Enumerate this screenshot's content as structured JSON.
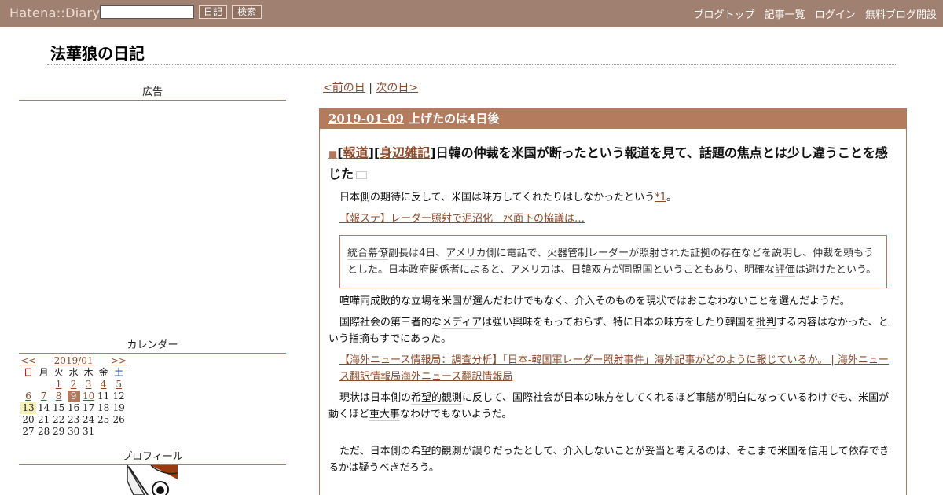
{
  "topbar": {
    "logo": "Hatena::Diary",
    "search_value": "",
    "diary_button": "日記",
    "search_button": "検索",
    "links": [
      "ブログトップ",
      "記事一覧",
      "ログイン",
      "無料ブログ開設"
    ]
  },
  "site_title": "法華狼の日記",
  "sidebar": {
    "ad_heading": "広告",
    "calendar_heading": "カレンダー",
    "profile_heading": "プロフィール",
    "calendar": {
      "prev": "<<",
      "month": "2019/01",
      "next": ">>",
      "weekdays": [
        "日",
        "月",
        "火",
        "水",
        "木",
        "金",
        "土"
      ],
      "weeks": [
        [
          "",
          "",
          "1",
          "2",
          "3",
          "4",
          "5"
        ],
        [
          "6",
          "7",
          "8",
          "9",
          "10",
          "11",
          "12"
        ],
        [
          "13",
          "14",
          "15",
          "16",
          "17",
          "18",
          "19"
        ],
        [
          "20",
          "21",
          "22",
          "23",
          "24",
          "25",
          "26"
        ],
        [
          "27",
          "28",
          "29",
          "30",
          "31",
          "",
          ""
        ]
      ],
      "linked_days": [
        "1",
        "2",
        "3",
        "4",
        "5",
        "6",
        "7",
        "8",
        "9",
        "10"
      ],
      "selected_day": "9",
      "today": "13"
    }
  },
  "pager": {
    "prev": "<前の日",
    "sep": "|",
    "next": "次の日>"
  },
  "entry": {
    "date": "2019-01-09",
    "header_title": "上げたのは4日後",
    "section": {
      "mark": "■",
      "category1": "報道",
      "category2": "身辺雑記",
      "title": "日韓の仲裁を米国が断ったという報道を見て、話題の焦点とは少し違うことを感じた"
    },
    "p1": "日本側の期待に反して、米国は味方してくれたりはしなかったという",
    "p1_footnote": "*1",
    "p1_end": "。",
    "link1": "【報ステ】レーダー照射で泥沼化　水面下の協議は…",
    "quote": {
      "kw1": "統合幕僚",
      "t1": "副長は4日、",
      "kw2": "アメリカ",
      "t2": "側に電話で、",
      "kw3": "火器管制レーダー",
      "t3": "が照射された証拠の存在などを説明し、仲裁を頼もうとした。日本政府関係者によると、アメリカは、日韓双方が同盟国ということもあり、明確な",
      "kw4": "評価",
      "t4": "は避けたという。"
    },
    "p2": "喧嘩両成敗的な立場を米国が選んだわけでもなく、介入そのものを現状ではおこなわないことを選んだようだ。",
    "p3a": "国際社会の第三者的な",
    "p3_kw": "メディア",
    "p3b": "は強い興味をもっておらず、特に日本の味方をしたり韓国を",
    "p3_kw2": "批判",
    "p3c": "する内容はなかった、という指摘もすでにあった。",
    "link2": "【海外ニュース情報局：調査分析】「日本-韓国軍レーダー照射事件」海外記事がどのように報じているか。 | 海外ニュース翻訳情報局海外ニュース翻訳情報局",
    "p4a": "現状は日本側の",
    "p4_kw": "希望的観測",
    "p4b": "に反して、国際社会が日本の味方をしてくれるほど事態が明白になっているわけでも、米国が動くほど",
    "p4_kw2": "重大事",
    "p4c": "なわけでもないようだ。",
    "p5": "ただ、日本側の希望的観測が誤りだったとして、介入しないことが妥当と考えるのは、そこまで米国を信用して依存できるかは疑うべきだろう。"
  }
}
